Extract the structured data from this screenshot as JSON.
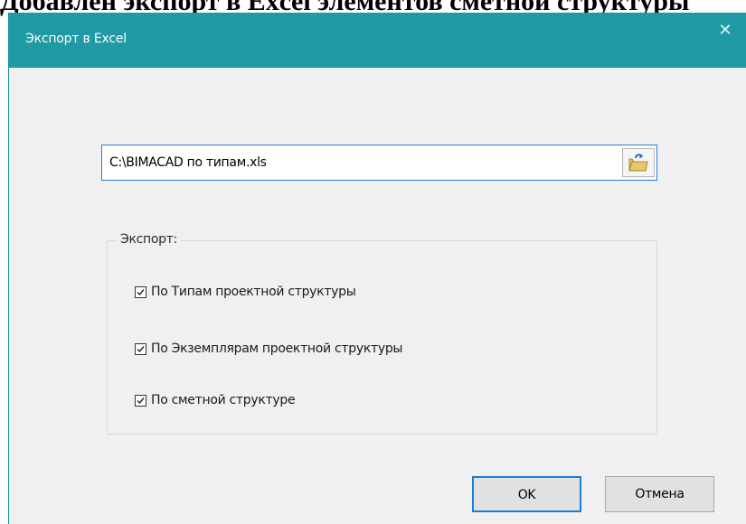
{
  "document": {
    "heading": "Добавлен экспорт в Excel элементов сметной структуры"
  },
  "window": {
    "title": "Экспорт в Excel",
    "close_glyph": "✕",
    "accent_color": "#1f9aa4"
  },
  "file_path": {
    "value": "C:\\BIMACAD по типам.xls",
    "browse_icon": "folder-open-icon"
  },
  "export_group": {
    "label": "Экспорт:",
    "options": [
      {
        "label": "По Типам проектной структуры",
        "checked": true
      },
      {
        "label": "По Экземплярам проектной структуры",
        "checked": true
      },
      {
        "label": "По сметной структуре",
        "checked": true
      }
    ]
  },
  "buttons": {
    "ok_label": "OK",
    "cancel_label": "Отмена"
  }
}
